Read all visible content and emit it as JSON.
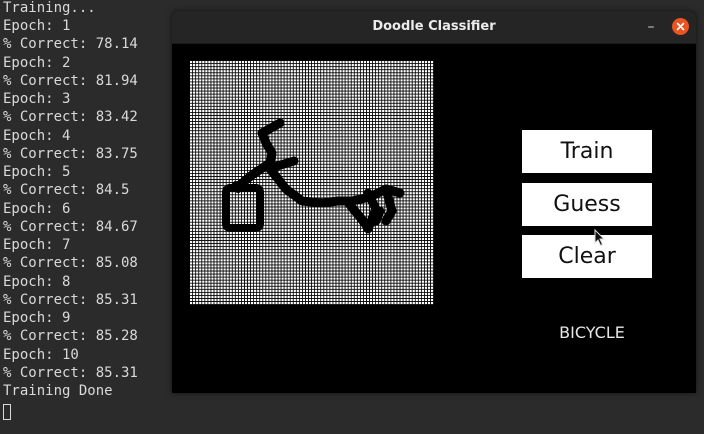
{
  "terminal": {
    "lines": [
      "Training...",
      "Epoch: 1",
      "% Correct: 78.14",
      "Epoch: 2",
      "% Correct: 81.94",
      "Epoch: 3",
      "% Correct: 83.42",
      "Epoch: 4",
      "% Correct: 83.75",
      "Epoch: 5",
      "% Correct: 84.5",
      "Epoch: 6",
      "% Correct: 84.67",
      "Epoch: 7",
      "% Correct: 85.08",
      "Epoch: 8",
      "% Correct: 85.31",
      "Epoch: 9",
      "% Correct: 85.28",
      "Epoch: 10",
      "% Correct: 85.31",
      "Training Done"
    ]
  },
  "window": {
    "title": "Doodle Classifier",
    "minimize_label": "–",
    "close_icon": "close-icon"
  },
  "app": {
    "train_label": "Train",
    "guess_label": "Guess",
    "clear_label": "Clear",
    "result": "BICYCLE"
  },
  "colors": {
    "terminal_bg": "#2b2b2b",
    "close_button": "#e95420",
    "canvas_grid": "#ffffff",
    "stroke": "#000000"
  }
}
